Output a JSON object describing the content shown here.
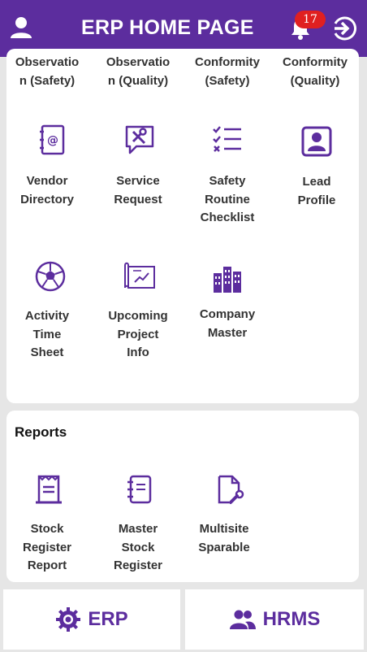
{
  "header": {
    "title": "ERP HOME PAGE",
    "notification_count": "17"
  },
  "colors": {
    "primary": "#5c2d9e",
    "badge": "#e02020"
  },
  "card1": {
    "top_row": [
      {
        "label": "Observatio\nn (Safety)",
        "icon": "cut-off"
      },
      {
        "label": "Observatio\nn (Quality)",
        "icon": "cut-off"
      },
      {
        "label": "Conformity\n(Safety)",
        "icon": "cut-off"
      },
      {
        "label": "Conformity\n(Quality)",
        "icon": "cut-off"
      }
    ],
    "row2": [
      {
        "label": "Vendor\nDirectory",
        "icon": "address-book-icon"
      },
      {
        "label": "Service\nRequest",
        "icon": "service-request-icon"
      },
      {
        "label": "Safety\nRoutine\nChecklist",
        "icon": "checklist-icon"
      },
      {
        "label": "Lead\nProfile",
        "icon": "profile-icon"
      }
    ],
    "row3": [
      {
        "label": "Activity\nTime\nSheet",
        "icon": "soccer-ball-icon"
      },
      {
        "label": "Upcoming\nProject\nInfo",
        "icon": "blueprint-icon"
      },
      {
        "label": "Company\nMaster",
        "icon": "city-icon"
      }
    ]
  },
  "reports": {
    "title": "Reports",
    "items": [
      {
        "label": "Stock\nRegister\nReport",
        "icon": "receipt-icon"
      },
      {
        "label": "Master\nStock\nRegister",
        "icon": "notebook-icon"
      },
      {
        "label": "Multisite\nSparable",
        "icon": "file-wrench-icon"
      }
    ]
  },
  "bottom_tabs": [
    {
      "label": "ERP",
      "icon": "gear-icon"
    },
    {
      "label": "HRMS",
      "icon": "people-icon"
    }
  ]
}
